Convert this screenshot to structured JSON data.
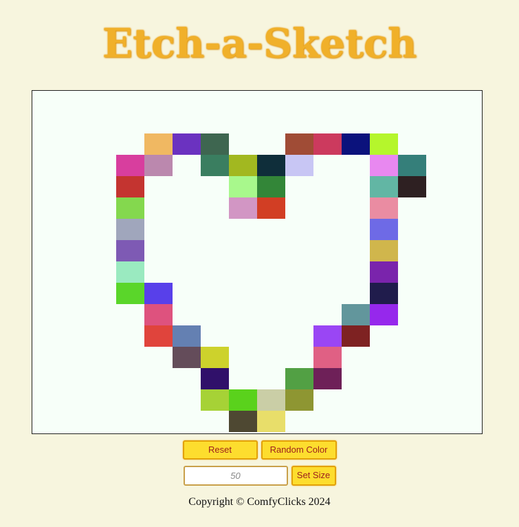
{
  "app": {
    "title": "Etch-a-Sketch"
  },
  "controls": {
    "reset_label": "Reset",
    "random_color_label": "Random Color",
    "size_placeholder": "50",
    "set_size_label": "Set Size"
  },
  "footer": {
    "text": "Copyright © ComfyClicks 2024"
  },
  "colors": {
    "background": "#f7f5de",
    "board": "#f7fff9",
    "button": "#fddd2e",
    "button_text": "#9c1d1d",
    "title": "#f0b02a"
  },
  "grid": {
    "columns": 16,
    "rows": 16,
    "painted": [
      {
        "c": 4,
        "r": 2,
        "color": "#f0b862"
      },
      {
        "c": 5,
        "r": 2,
        "color": "#6b32c0"
      },
      {
        "c": 6,
        "r": 2,
        "color": "#3e6650"
      },
      {
        "c": 9,
        "r": 2,
        "color": "#a04c36"
      },
      {
        "c": 10,
        "r": 2,
        "color": "#cc3a5e"
      },
      {
        "c": 11,
        "r": 2,
        "color": "#0b127c"
      },
      {
        "c": 12,
        "r": 2,
        "color": "#b5f62c"
      },
      {
        "c": 3,
        "r": 3,
        "color": "#d83e9e"
      },
      {
        "c": 4,
        "r": 3,
        "color": "#bb88ae"
      },
      {
        "c": 6,
        "r": 3,
        "color": "#3a7e60"
      },
      {
        "c": 7,
        "r": 3,
        "color": "#a2b820"
      },
      {
        "c": 8,
        "r": 3,
        "color": "#0f2e3a"
      },
      {
        "c": 9,
        "r": 3,
        "color": "#c8c6f4"
      },
      {
        "c": 12,
        "r": 3,
        "color": "#e888f0"
      },
      {
        "c": 13,
        "r": 3,
        "color": "#357f7a"
      },
      {
        "c": 3,
        "r": 4,
        "color": "#c43430"
      },
      {
        "c": 7,
        "r": 4,
        "color": "#a8f88c"
      },
      {
        "c": 8,
        "r": 4,
        "color": "#338638"
      },
      {
        "c": 12,
        "r": 4,
        "color": "#62b6a4"
      },
      {
        "c": 13,
        "r": 4,
        "color": "#2e2022"
      },
      {
        "c": 3,
        "r": 5,
        "color": "#84d84e"
      },
      {
        "c": 7,
        "r": 5,
        "color": "#d296c4"
      },
      {
        "c": 8,
        "r": 5,
        "color": "#d23e24"
      },
      {
        "c": 12,
        "r": 5,
        "color": "#ea8ca2"
      },
      {
        "c": 3,
        "r": 6,
        "color": "#a0a6bc"
      },
      {
        "c": 12,
        "r": 6,
        "color": "#6e6ae6"
      },
      {
        "c": 3,
        "r": 7,
        "color": "#7e5ab4"
      },
      {
        "c": 12,
        "r": 7,
        "color": "#d0b64c"
      },
      {
        "c": 3,
        "r": 8,
        "color": "#9aeac0"
      },
      {
        "c": 12,
        "r": 8,
        "color": "#7a24ac"
      },
      {
        "c": 3,
        "r": 9,
        "color": "#5ad62a"
      },
      {
        "c": 4,
        "r": 9,
        "color": "#5840ea"
      },
      {
        "c": 12,
        "r": 9,
        "color": "#201c4c"
      },
      {
        "c": 4,
        "r": 10,
        "color": "#de527e"
      },
      {
        "c": 11,
        "r": 10,
        "color": "#62969c"
      },
      {
        "c": 12,
        "r": 10,
        "color": "#9628ec"
      },
      {
        "c": 4,
        "r": 11,
        "color": "#e0443c"
      },
      {
        "c": 5,
        "r": 11,
        "color": "#6480b2"
      },
      {
        "c": 10,
        "r": 11,
        "color": "#9a46f4"
      },
      {
        "c": 11,
        "r": 11,
        "color": "#7e2222"
      },
      {
        "c": 5,
        "r": 12,
        "color": "#644c5a"
      },
      {
        "c": 6,
        "r": 12,
        "color": "#cdd22c"
      },
      {
        "c": 10,
        "r": 12,
        "color": "#e06084"
      },
      {
        "c": 6,
        "r": 13,
        "color": "#30106a"
      },
      {
        "c": 9,
        "r": 13,
        "color": "#52a044"
      },
      {
        "c": 10,
        "r": 13,
        "color": "#6e2058"
      },
      {
        "c": 6,
        "r": 14,
        "color": "#a6d236"
      },
      {
        "c": 7,
        "r": 14,
        "color": "#5ad21c"
      },
      {
        "c": 8,
        "r": 14,
        "color": "#cacea6"
      },
      {
        "c": 9,
        "r": 14,
        "color": "#8e9632"
      },
      {
        "c": 7,
        "r": 15,
        "color": "#4e4832"
      },
      {
        "c": 8,
        "r": 15,
        "color": "#e8de6a"
      }
    ]
  }
}
